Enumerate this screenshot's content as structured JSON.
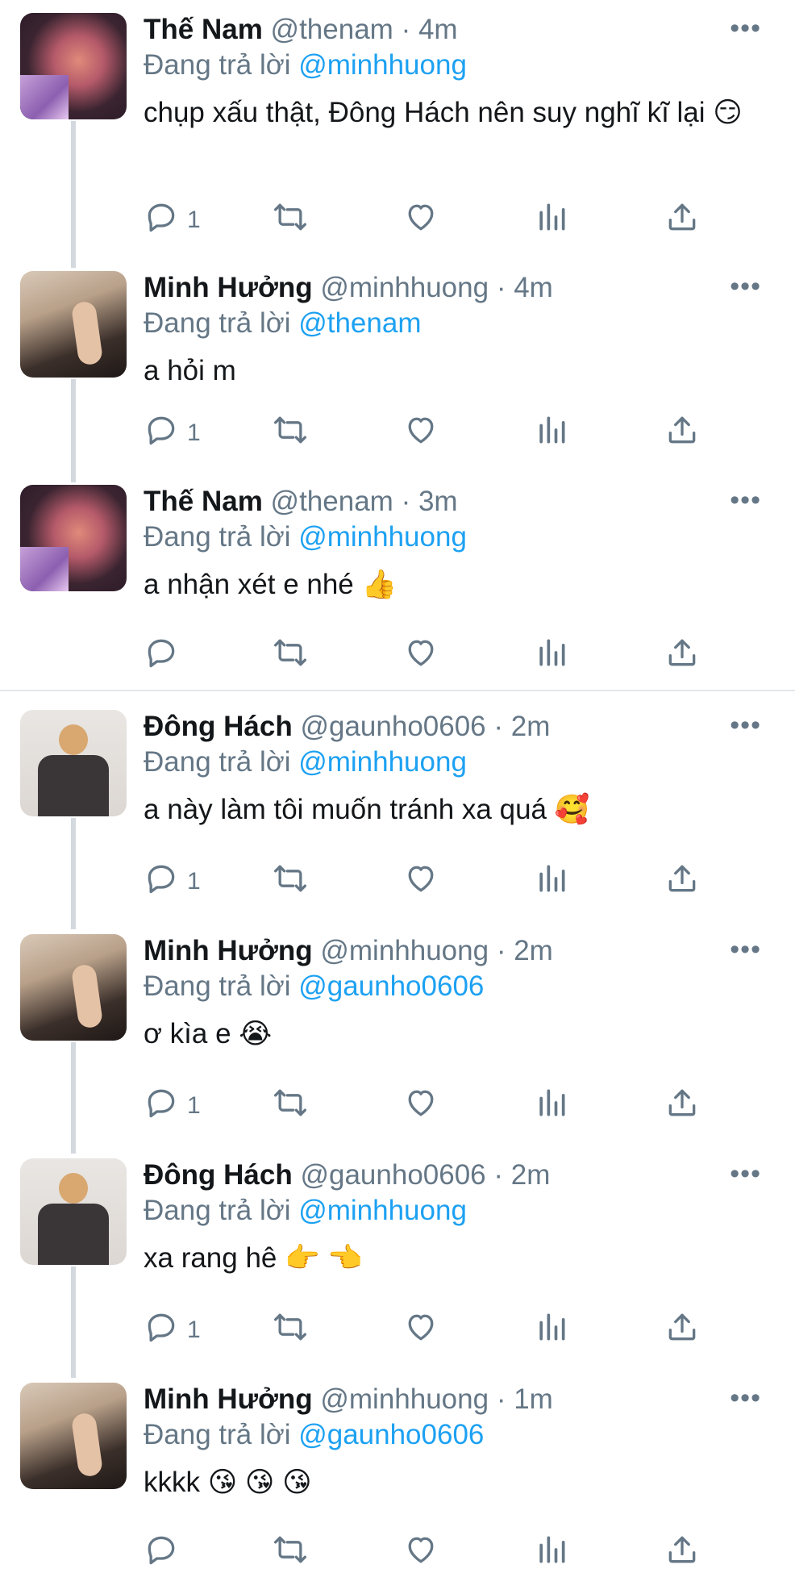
{
  "tweets": [
    {
      "name": "Thế Nam",
      "handle": "@thenam",
      "time": "· 4m",
      "reply_prefix": "Đang trả lời",
      "reply_to": "@minhhuong",
      "text": "chụp xấu thật, Đông Hách nên suy nghĩ kĩ lại 😏",
      "reply_count": "1"
    },
    {
      "name": "Minh Hưởng",
      "handle": "@minhhuong",
      "time": "· 4m",
      "reply_prefix": "Đang trả lời",
      "reply_to": "@thenam",
      "text": "a hỏi m",
      "reply_count": "1"
    },
    {
      "name": "Thế Nam",
      "handle": "@thenam",
      "time": "· 3m",
      "reply_prefix": "Đang trả lời",
      "reply_to": "@minhhuong",
      "text": "a nhận xét e nhé 👍",
      "reply_count": ""
    },
    {
      "name": "Đông Hách",
      "handle": "@gaunho0606",
      "time": "· 2m",
      "reply_prefix": "Đang trả lời",
      "reply_to": "@minhhuong",
      "text": "a này làm tôi muốn tránh xa quá 🥰",
      "reply_count": "1"
    },
    {
      "name": "Minh Hưởng",
      "handle": "@minhhuong",
      "time": "· 2m",
      "reply_prefix": "Đang trả lời",
      "reply_to": "@gaunho0606",
      "text": "ơ kìa e 😭",
      "reply_count": "1"
    },
    {
      "name": "Đông Hách",
      "handle": "@gaunho0606",
      "time": "· 2m",
      "reply_prefix": "Đang trả lời",
      "reply_to": "@minhhuong",
      "text": "xa rang hê 👉 👈",
      "reply_count": "1"
    },
    {
      "name": "Minh Hưởng",
      "handle": "@minhhuong",
      "time": "· 1m",
      "reply_prefix": "Đang trả lời",
      "reply_to": "@gaunho0606",
      "text": "kkkk 😘 😘 😘",
      "reply_count": ""
    }
  ],
  "icons": {
    "more": "more-horizontal-icon",
    "reply": "reply-bubble-icon",
    "retweet": "retweet-icon",
    "like": "heart-icon",
    "analytics": "analytics-icon",
    "share": "share-icon"
  },
  "colors": {
    "text": "#14171a",
    "muted": "#657786",
    "link": "#1da1f2",
    "divider": "#e1e8ed",
    "thread_line": "#d3d9de"
  }
}
